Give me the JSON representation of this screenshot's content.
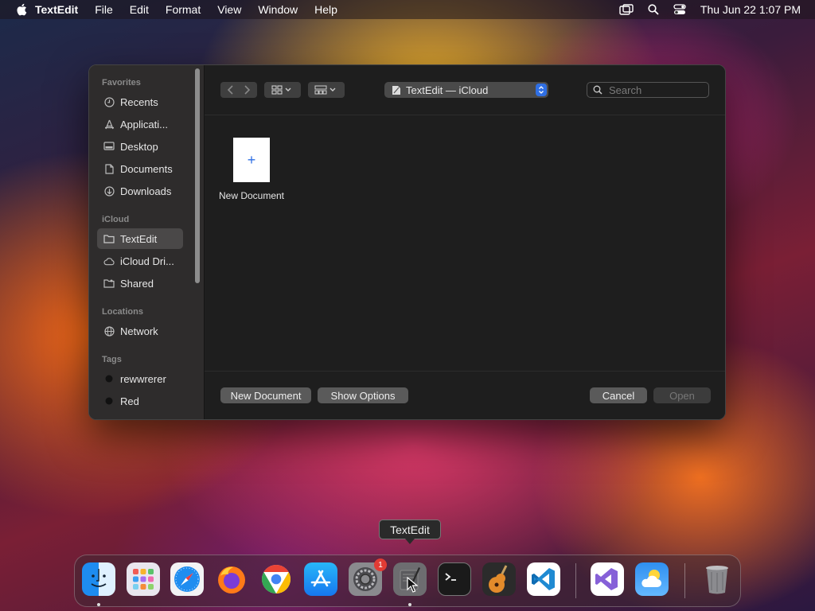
{
  "menubar": {
    "app_name": "TextEdit",
    "items": [
      "File",
      "Edit",
      "Format",
      "View",
      "Window",
      "Help"
    ],
    "clock": "Thu Jun 22  1:07 PM"
  },
  "sidebar": {
    "sections": [
      {
        "title": "Favorites",
        "items": [
          {
            "label": "Recents",
            "icon": "clock-icon"
          },
          {
            "label": "Applicati...",
            "icon": "applications-icon"
          },
          {
            "label": "Desktop",
            "icon": "desktop-icon"
          },
          {
            "label": "Documents",
            "icon": "document-icon"
          },
          {
            "label": "Downloads",
            "icon": "download-icon"
          }
        ]
      },
      {
        "title": "iCloud",
        "items": [
          {
            "label": "TextEdit",
            "icon": "folder-icon",
            "selected": true
          },
          {
            "label": "iCloud Dri...",
            "icon": "cloud-icon"
          },
          {
            "label": "Shared",
            "icon": "shared-folder-icon"
          }
        ]
      },
      {
        "title": "Locations",
        "items": [
          {
            "label": "Network",
            "icon": "network-icon"
          }
        ]
      },
      {
        "title": "Tags",
        "items": [
          {
            "label": "rewwrerer",
            "icon": "tag-dot-icon"
          },
          {
            "label": "Red",
            "icon": "tag-dot-icon"
          }
        ]
      }
    ]
  },
  "toolbar": {
    "location": "TextEdit — iCloud",
    "search_placeholder": "Search"
  },
  "content": {
    "new_doc_label": "New Document"
  },
  "buttons": {
    "new_document": "New Document",
    "show_options": "Show Options",
    "cancel": "Cancel",
    "open": "Open"
  },
  "dock": {
    "tooltip": "TextEdit",
    "settings_badge": "1",
    "apps": [
      "Finder",
      "Launchpad",
      "Safari",
      "Firefox",
      "Chrome",
      "App Store",
      "System Settings",
      "TextEdit",
      "Terminal",
      "GarageBand",
      "Visual Studio Code",
      "Visual Studio",
      "Weather",
      "Trash"
    ]
  },
  "colors": {
    "accent": "#2f6fe4",
    "badge": "#e23b34",
    "dialog_bg": "#1e1e1e",
    "sidebar_bg": "#2e2c2c"
  }
}
